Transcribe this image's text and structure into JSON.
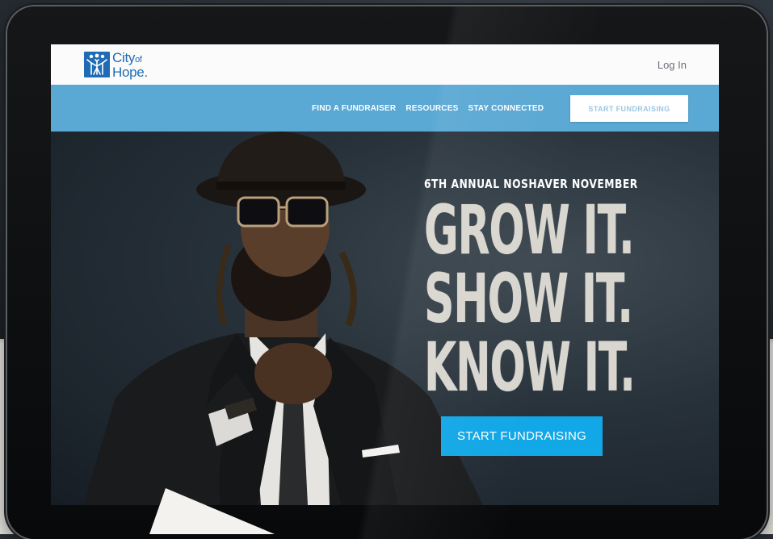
{
  "colors": {
    "brand_blue": "#1f6cb5",
    "nav_blue": "#5aa8d4",
    "cta_blue": "#12a7e6"
  },
  "header": {
    "logo_line1": "City",
    "logo_line1_small": "of",
    "logo_line2": "Hope.",
    "login_label": "Log In"
  },
  "nav": {
    "items": [
      {
        "label": "FIND A FUNDRAISER"
      },
      {
        "label": "RESOURCES"
      },
      {
        "label": "STAY CONNECTED"
      }
    ],
    "cta_label": "START FUNDRAISING"
  },
  "hero": {
    "subtitle": "6TH ANNUAL NOSHAVER NOVEMBER",
    "line1": "GROW IT.",
    "line2": "SHOW IT.",
    "line3": "KNOW IT.",
    "cta_label": "START FUNDRAISING"
  },
  "icons": {
    "logo": "city-of-hope-figures-icon"
  }
}
